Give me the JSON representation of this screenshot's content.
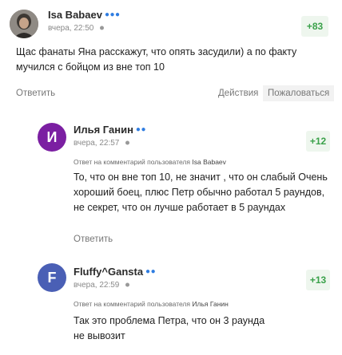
{
  "colors": {
    "accent": "#2f7de1",
    "score_green": "#3aa14a",
    "avatar_purple": "#7b1fa2",
    "avatar_blue": "#4a5fb5"
  },
  "comments": [
    {
      "author": "Isa Babaev",
      "badge_dots": "●●●",
      "time": "вчера, 22:50",
      "score": "+83",
      "text": "Щас фанаты Яна расскажут, что опять засудили) а по факту мучился с бойцом из вне топ 10",
      "reply_label": "Ответить",
      "actions_label": "Действия",
      "report_label": "Пожаловаться"
    },
    {
      "author": "Илья Ганин",
      "badge_dots": "●●",
      "avatar_letter": "И",
      "time": "вчера, 22:57",
      "score": "+12",
      "reply_prefix": "Ответ на комментарий пользователя",
      "reply_user": "Isa Babaev",
      "text": "То, что он вне топ 10, не значит , что он слабый Очень хороший боец, плюс Петр обычно работал 5 раундов, не секрет, что он лучше работает в 5 раундах",
      "reply_label": "Ответить"
    },
    {
      "author": "Fluffy^Gansta",
      "badge_dots": "●●",
      "avatar_letter": "F",
      "time": "вчера, 22:59",
      "score": "+13",
      "reply_prefix": "Ответ на комментарий пользователя",
      "reply_user": "Илья Ганин",
      "text": "Так это проблема Петра, что он 3 раунда не вывозит"
    }
  ]
}
